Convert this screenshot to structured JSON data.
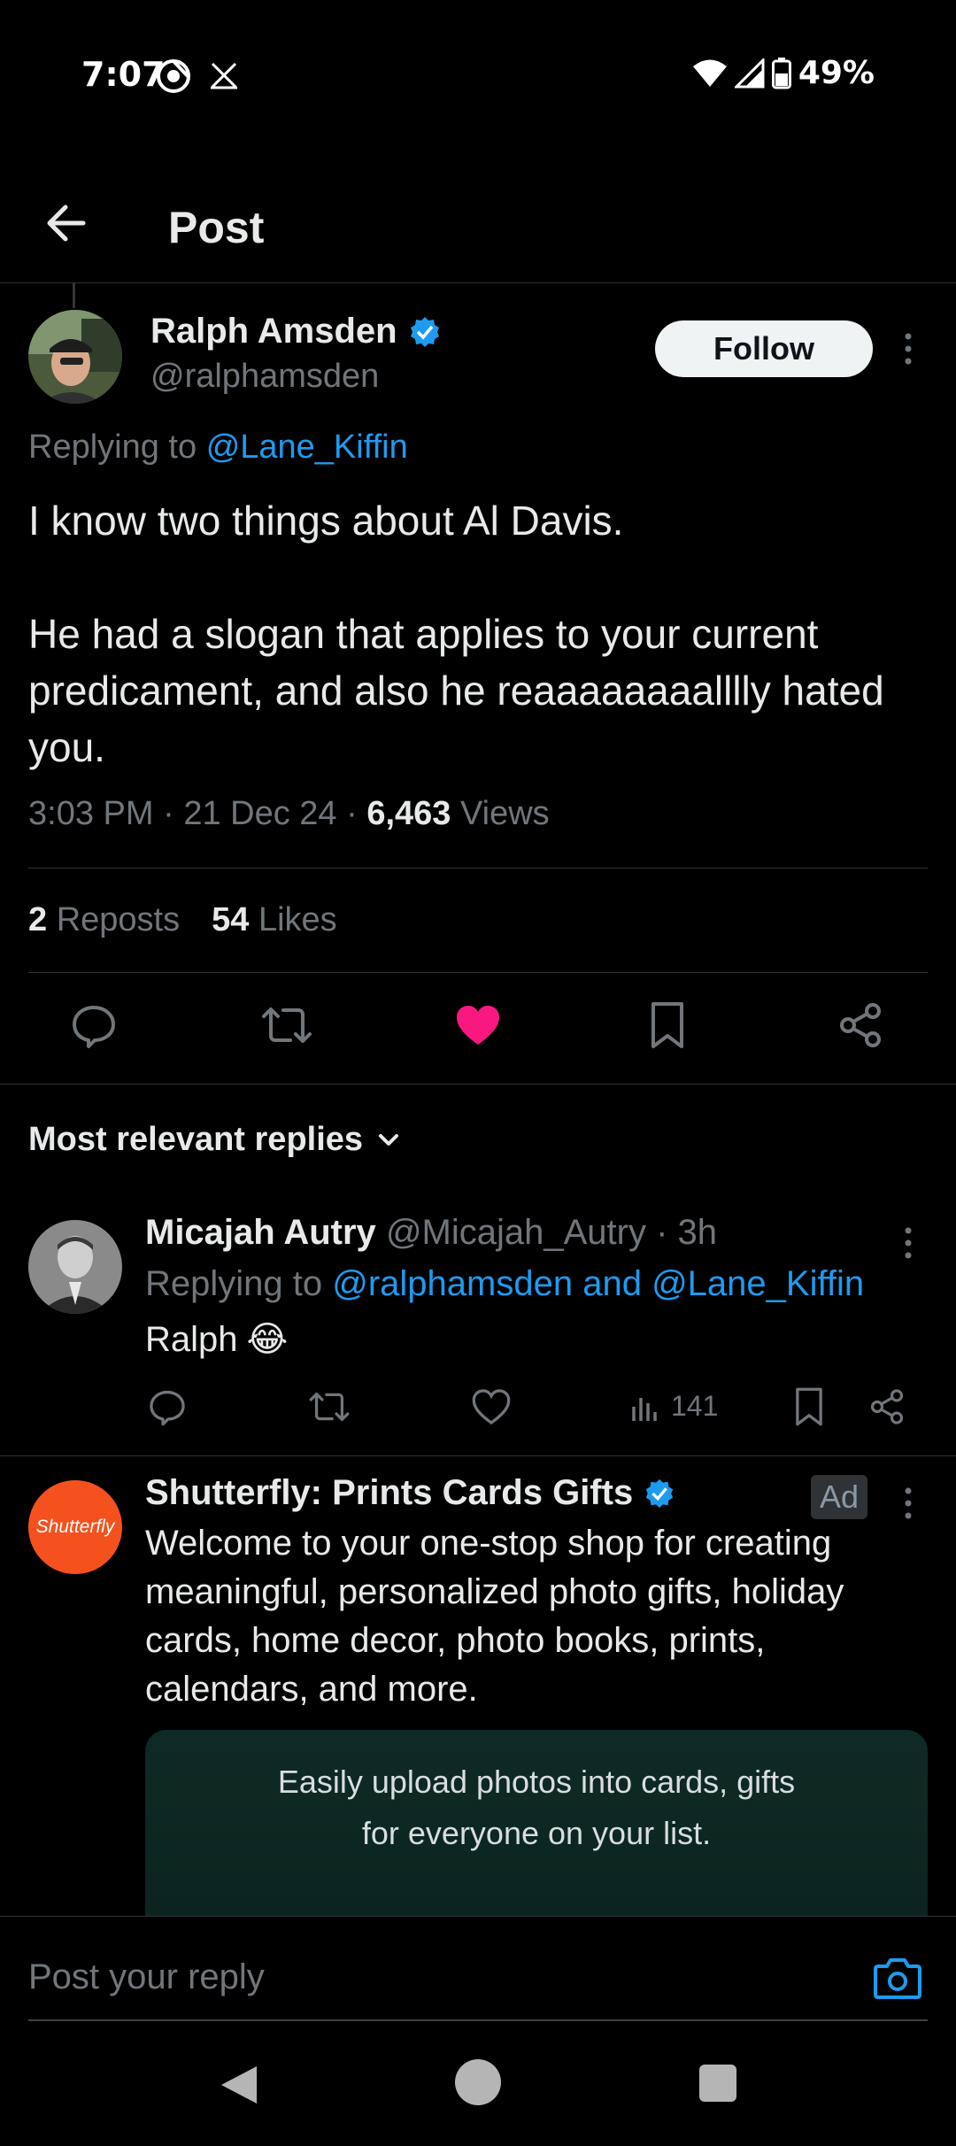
{
  "status_bar": {
    "time": "7:07",
    "battery": "49%",
    "icons": [
      "chrome-like-icon",
      "x-icon",
      "wifi-icon",
      "signal-icon",
      "battery-icon"
    ]
  },
  "nav": {
    "title": "Post"
  },
  "post": {
    "author_name": "Ralph Amsden",
    "author_handle": "@ralphamsden",
    "follow_label": "Follow",
    "replying_prefix": "Replying to",
    "replying_to": "@Lane_Kiffin",
    "body": "I know two things about Al Davis.\n\nHe had a slogan that applies to your current predicament, and also he reaaaaaaaalllly hated you.",
    "time": "3:03 PM",
    "date": "21 Dec 24",
    "views_count": "6,463",
    "views_label": "Views",
    "reposts_count": "2",
    "reposts_label": "Reposts",
    "likes_count": "54",
    "likes_label": "Likes",
    "liked": true
  },
  "replies_header": {
    "label": "Most relevant replies"
  },
  "reply": {
    "name": "Micajah Autry",
    "handle": "@Micajah_Autry",
    "age": "3h",
    "replying_prefix": "Replying to",
    "replying_to": "@ralphamsden and @Lane_Kiffin",
    "text": "Ralph",
    "emoji": "😂",
    "views": "141"
  },
  "ad": {
    "name": "Shutterfly: Prints Cards Gifts",
    "avatar_text": "Shutterfly",
    "badge": "Ad",
    "text": "Welcome to your one-stop shop for creating meaningful, personalized photo gifts, holiday cards, home decor, photo books, prints, calendars, and more.",
    "media_line1": "Easily upload photos into cards, gifts",
    "media_line2": "for everyone on your list."
  },
  "composer": {
    "placeholder": "Post your reply"
  },
  "colors": {
    "background": "#000000",
    "accent": "#1d9bf0",
    "like": "#f91880",
    "muted": "#71767b",
    "ad_avatar": "#f4511e"
  }
}
